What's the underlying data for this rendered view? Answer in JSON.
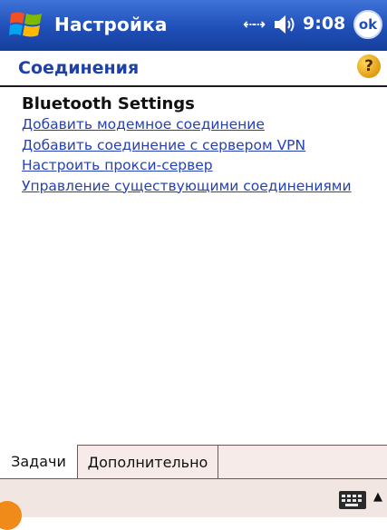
{
  "titlebar": {
    "app_title": "Настройка",
    "time": "9:08",
    "ok_label": "ok"
  },
  "header": {
    "page_title": "Соединения",
    "help_label": "?"
  },
  "content": {
    "heading": "Bluetooth Settings",
    "links": [
      "Добавить модемное соединение",
      "Добавить соединение с сервером VPN",
      "Настроить прокси-сервер",
      "Управление существующими соединениями"
    ]
  },
  "tabs": [
    "Задачи",
    "Дополнительно"
  ],
  "icons": {
    "start": "windows-flag-icon",
    "connectivity": "connectivity-icon",
    "volume": "speaker-icon",
    "help": "help-icon",
    "keyboard": "keyboard-icon"
  },
  "colors": {
    "titlebar": "#1f4fb8",
    "title_text": "#1e40a8",
    "link": "#2541b5",
    "tab_bg": "#f6ebe8"
  }
}
